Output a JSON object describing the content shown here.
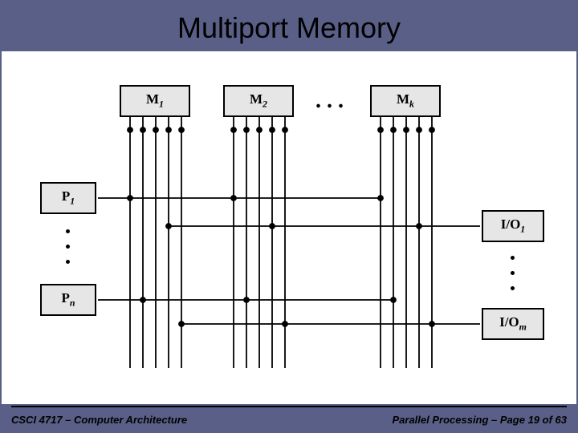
{
  "title": "Multiport Memory",
  "footer_left": "CSCI 4717 – Computer Architecture",
  "footer_right": "Parallel Processing – Page 19 of 63",
  "boxes": {
    "m1": "M",
    "m1s": "1",
    "m2": "M",
    "m2s": "2",
    "mk": "M",
    "mks": "k",
    "p1": "P",
    "p1s": "1",
    "pn": "P",
    "pns": "n",
    "io1": "I/O",
    "io1s": "1",
    "iom": "I/O",
    "ioms": "m"
  },
  "ellipsis": ". . ."
}
